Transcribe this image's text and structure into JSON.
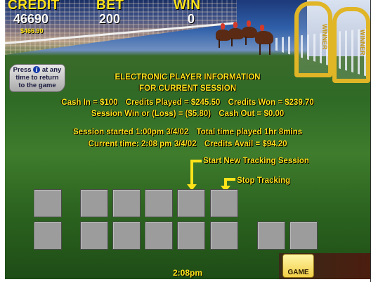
{
  "hud": {
    "credit_label": "CREDIT",
    "credit_value": "46690",
    "credit_dollars": "$466.90",
    "bet_label": "BET",
    "bet_value": "200",
    "win_label": "WIN",
    "win_value": "0"
  },
  "scenery": {
    "arch_text": "WINNER"
  },
  "press_button": {
    "line1_pre": "Press",
    "info_glyph": "i",
    "line1_post": "at any",
    "line2": "time to return",
    "line3": "to the game"
  },
  "info": {
    "title_line1": "ELECTRONIC PLAYER INFORMATION",
    "title_line2": "FOR CURRENT SESSION",
    "cash_in": "Cash In = $100",
    "credits_played": "Credits Played = $245.50",
    "credits_won": "Credits Won = $239.70",
    "session_win_loss": "Session Win or (Loss) = ($5.80)",
    "cash_out": "Cash Out = $0.00",
    "session_started": "Session started 1:00pm 3/4/02",
    "total_time": "Total time played 1hr 8mins",
    "current_time": "Current time: 2:08 pm 3/4/02",
    "credits_avail": "Credits Avail = $94.20"
  },
  "callouts": {
    "start_new": "Start New Tracking Session",
    "stop": "Stop Tracking"
  },
  "footer": {
    "clock": "2:08pm",
    "game_button": "GAME"
  },
  "colors": {
    "accent_yellow": "#ffe31a",
    "button_gray": "#9c9c9c"
  }
}
